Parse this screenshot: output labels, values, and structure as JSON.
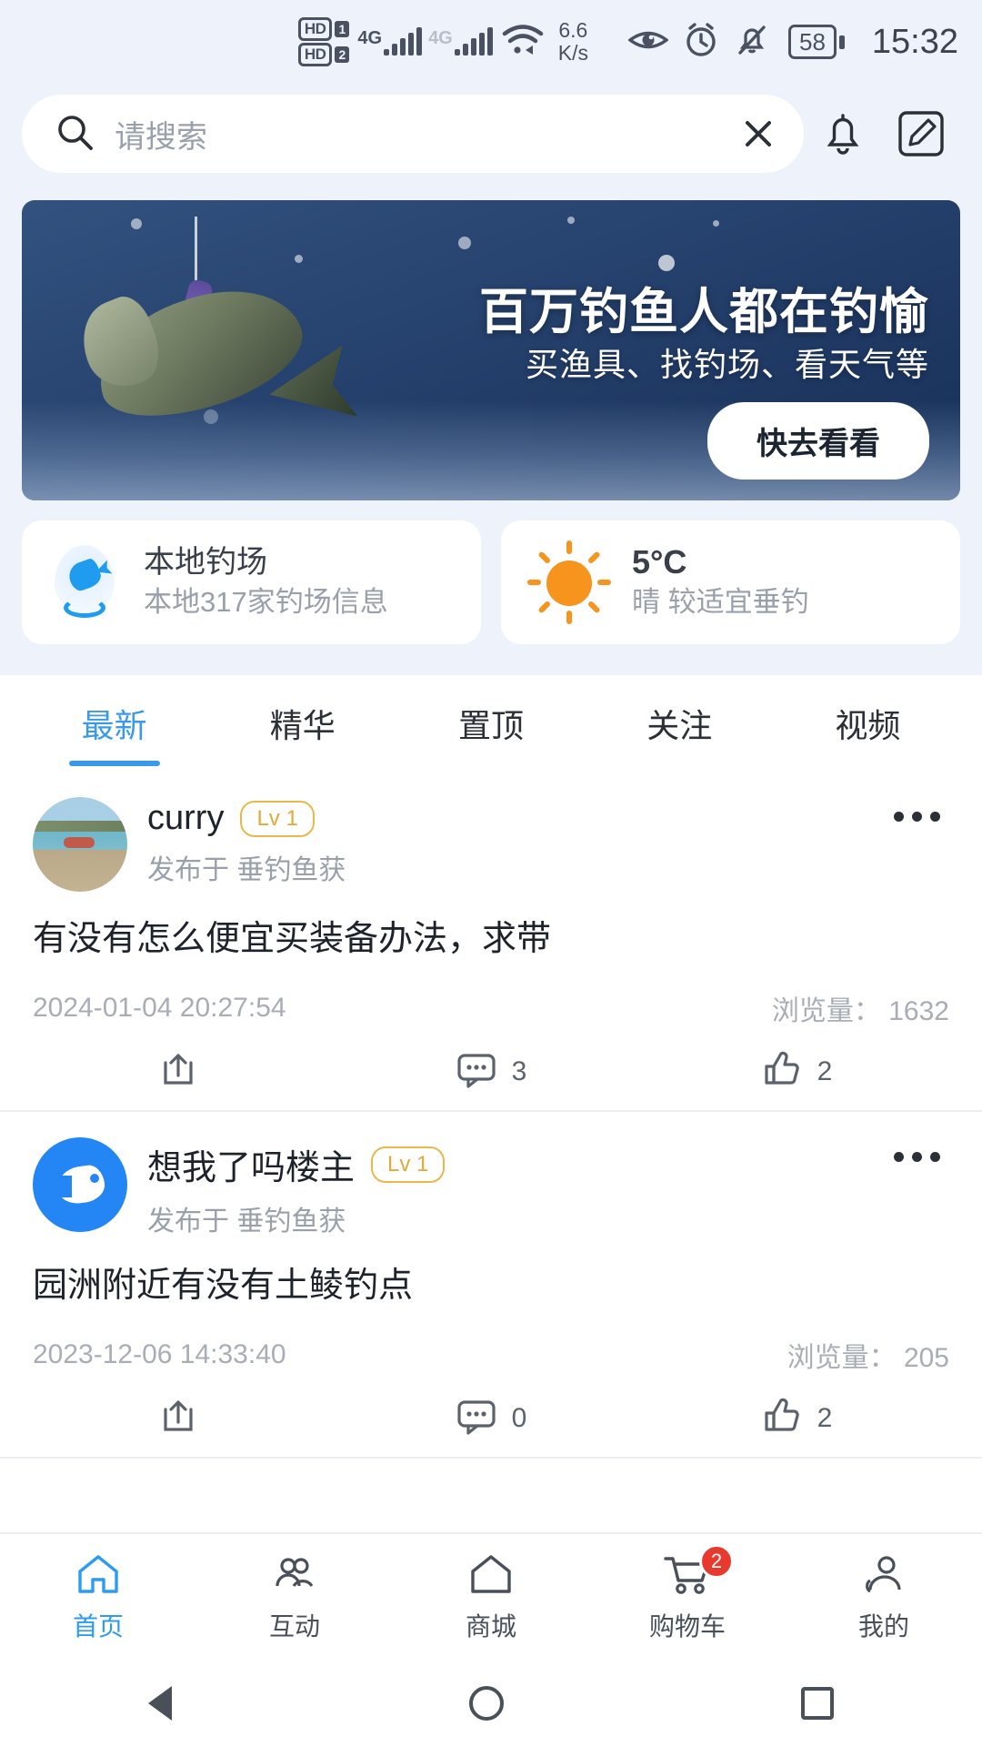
{
  "statusbar": {
    "hd1_label": "HD",
    "hd1_num": "1",
    "hd2_label": "HD",
    "hd2_num": "2",
    "sim1_net": "4G",
    "sim2_net": "4G",
    "netspeed_value": "6.6",
    "netspeed_unit": "K/s",
    "battery_percent": "58",
    "time": "15:32",
    "icons": [
      "eye-icon",
      "alarm-icon",
      "bell-muted-icon"
    ]
  },
  "search": {
    "placeholder": "请搜索",
    "clear_label": "×",
    "notification_icon": "bell-icon",
    "compose_icon": "compose-icon"
  },
  "banner": {
    "title": "百万钓鱼人都在钓愉",
    "subtitle": "买渔具、找钓场、看天气等",
    "button_label": "快去看看"
  },
  "cards": [
    {
      "icon": "fish-pin-icon",
      "title": "本地钓场",
      "subtitle": "本地317家钓场信息"
    },
    {
      "icon": "sun-icon",
      "temperature": "5°C",
      "subtitle": "晴 较适宜垂钓"
    }
  ],
  "tabs": [
    {
      "label": "最新",
      "active": true
    },
    {
      "label": "精华",
      "active": false
    },
    {
      "label": "置顶",
      "active": false
    },
    {
      "label": "关注",
      "active": false
    },
    {
      "label": "视频",
      "active": false
    }
  ],
  "posts": [
    {
      "avatar_type": "photo",
      "username": "curry",
      "level": "Lv 1",
      "posted_in": "发布于  垂钓鱼获",
      "title": "有没有怎么便宜买装备办法，求带",
      "date": "2024-01-04 20:27:54",
      "views_label": "浏览量：",
      "views": "1632",
      "share_count": "",
      "comment_count": "3",
      "like_count": "2",
      "more_label": "•••"
    },
    {
      "avatar_type": "brand",
      "username": "想我了吗楼主",
      "level": "Lv 1",
      "posted_in": "发布于  垂钓鱼获",
      "title": "园洲附近有没有土鲮钓点",
      "date": "2023-12-06 14:33:40",
      "views_label": "浏览量：",
      "views": "205",
      "share_count": "",
      "comment_count": "0",
      "like_count": "2",
      "more_label": "•••"
    }
  ],
  "bottomnav": [
    {
      "label": "首页",
      "icon": "home-icon",
      "active": true,
      "badge": ""
    },
    {
      "label": "互动",
      "icon": "interact-icon",
      "active": false,
      "badge": ""
    },
    {
      "label": "商城",
      "icon": "shop-icon",
      "active": false,
      "badge": ""
    },
    {
      "label": "购物车",
      "icon": "cart-icon",
      "active": false,
      "badge": "2"
    },
    {
      "label": "我的",
      "icon": "profile-icon",
      "active": false,
      "badge": ""
    }
  ],
  "colors": {
    "accent": "#2b9cf0",
    "tab_active": "#3a9ae8",
    "badge": "#e8392f",
    "level_border": "#e8b84b",
    "header_bg": "#eef2fb"
  }
}
